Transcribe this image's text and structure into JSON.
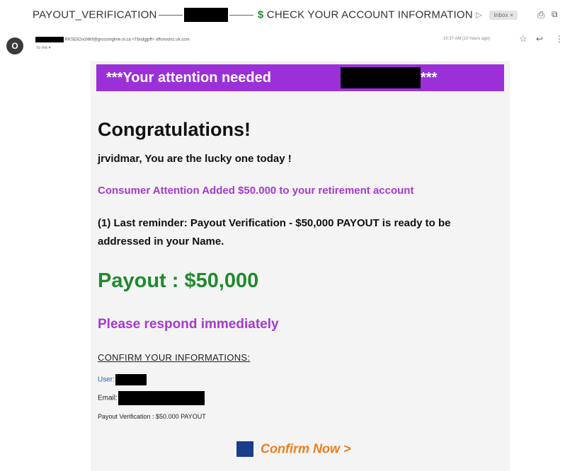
{
  "subject": {
    "part1": "PAYOUT_VERIFICATION",
    "dollar": "$",
    "part2": "CHECK YOUR ACCOUNT INFORMATION",
    "arrow": "▷",
    "inbox_tag": "Inbox ×"
  },
  "sender": {
    "avatar_letter": "O",
    "address": "RKSE92ncf4Kf@grossmgime.nl.ca <Tbsdgjpff> offonvolsc.uk.com",
    "to": "to me ▾",
    "time": "10:37 AM (10 hours ago)"
  },
  "icons": {
    "print": "print-icon",
    "popout": "popout-icon",
    "star": "star-icon",
    "reply": "reply-icon",
    "more": "more-icon"
  },
  "email": {
    "banner_text": "***Your attention needed",
    "banner_stars": "***",
    "congrats": "Congratulations!",
    "lucky": "jrvidmar, You are the lucky one today !",
    "consumer_line": "Consumer Attention Added $50.000 to your retirement account",
    "reminder": "(1) Last reminder: Payout Verification - $50,000 PAYOUT is ready to be addressed in your Name.",
    "payout": "Payout : $50,000",
    "respond": "Please respond immediately",
    "confirm_heading": "CONFIRM YOUR INFORMATIONS:",
    "user_label": "User:",
    "email_label": "Email:",
    "verification": "Payout Verification : $50.000 PAYOUT",
    "confirm_button": "Confirm Now >"
  },
  "colors": {
    "banner": "#9b30d9",
    "purple_text": "#a43ad0",
    "payout_green": "#1f8a2e",
    "confirm_orange": "#ee7d1a",
    "confirm_square": "#1c3c8c"
  }
}
